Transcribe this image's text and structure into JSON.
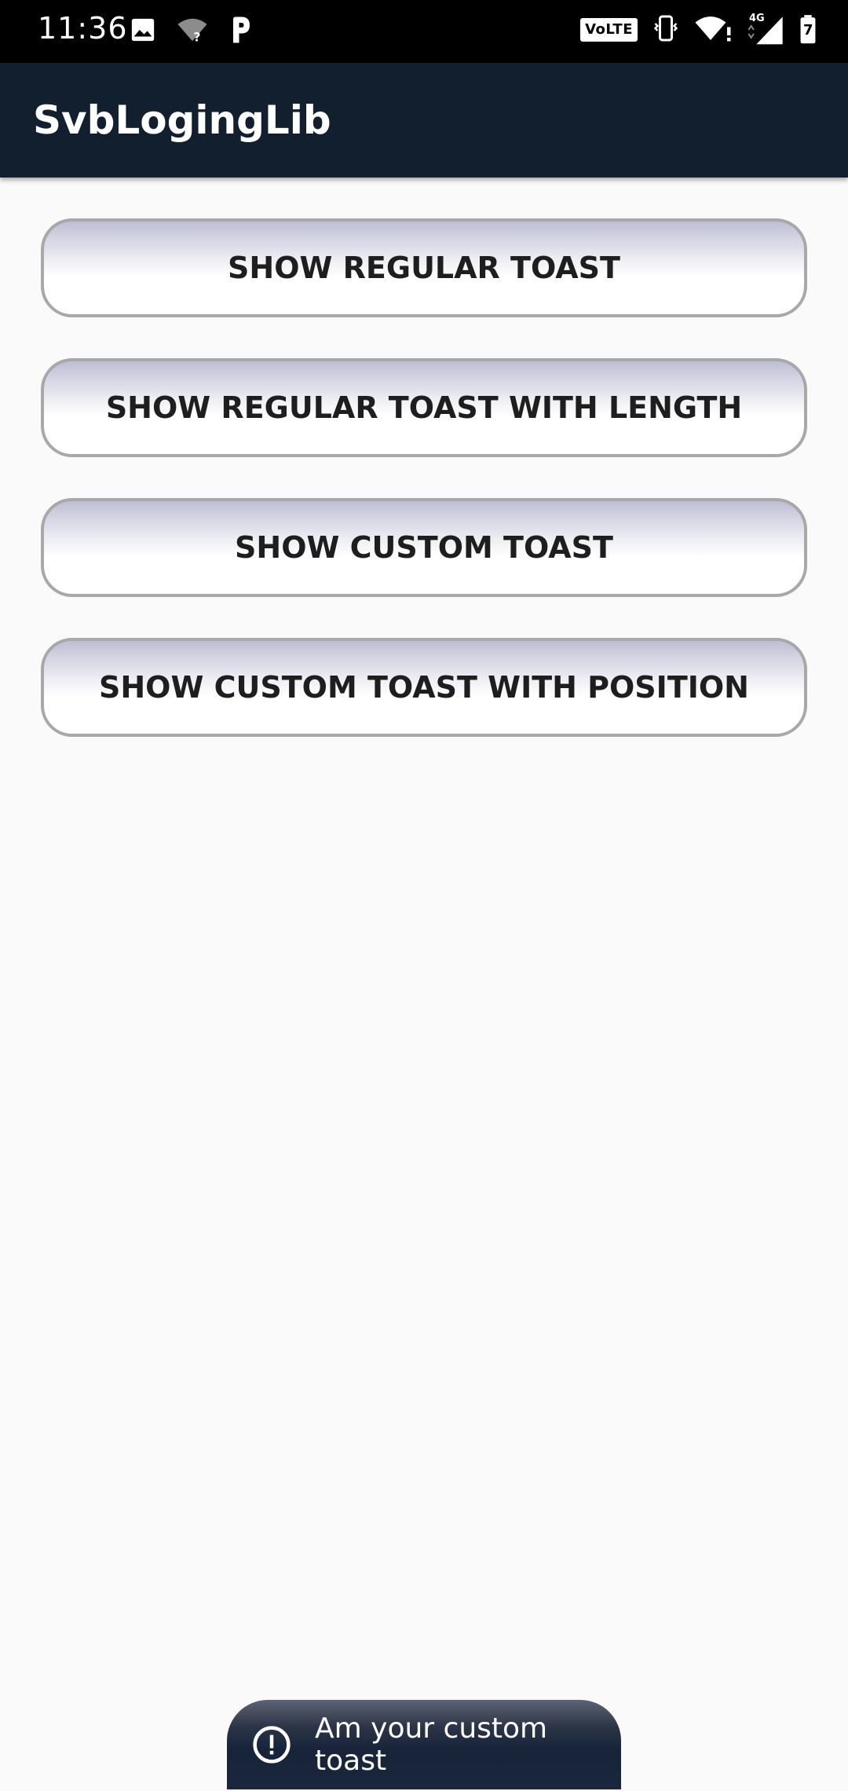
{
  "status_bar": {
    "time": "11:36",
    "left_icons": [
      "image-icon",
      "wifi-unknown-icon",
      "parking-app-icon"
    ],
    "volte_label": "VoLTE",
    "network_label": "4G",
    "battery_level": "7",
    "right_icons": [
      "volte-icon",
      "vibrate-icon",
      "wifi-alert-icon",
      "signal-icon",
      "battery-icon"
    ]
  },
  "app_bar": {
    "title": "SvbLogingLib"
  },
  "buttons": [
    {
      "label": "SHOW REGULAR TOAST"
    },
    {
      "label": "SHOW REGULAR TOAST WITH LENGTH"
    },
    {
      "label": "SHOW CUSTOM TOAST"
    },
    {
      "label": "SHOW CUSTOM TOAST WITH POSITION"
    }
  ],
  "toast": {
    "icon": "alert-circle-icon",
    "message": "Am your custom toast"
  },
  "colors": {
    "status_bar": "#000000",
    "app_bar": "#111f2e",
    "background": "#fafafa",
    "button_border": "#a8a8ab",
    "button_text": "#1e1e1e",
    "toast_bg": "#17243a"
  }
}
